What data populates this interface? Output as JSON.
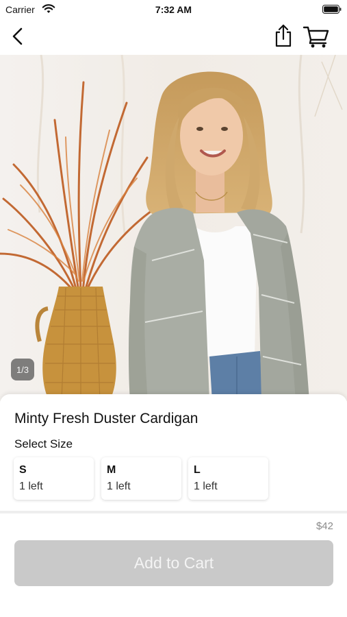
{
  "status_bar": {
    "carrier": "Carrier",
    "time": "7:32 AM"
  },
  "nav_bar": {
    "back_icon": "chevron-left-icon",
    "share_icon": "share-icon",
    "cart_icon": "cart-icon"
  },
  "gallery": {
    "counter": "1/3"
  },
  "product": {
    "title": "Minty Fresh Duster Cardigan",
    "select_size_label": "Select Size",
    "sizes": [
      {
        "label": "S",
        "stock": "1 left"
      },
      {
        "label": "M",
        "stock": "1 left"
      },
      {
        "label": "L",
        "stock": "1 left"
      }
    ],
    "price": "$42",
    "add_to_cart_label": "Add to Cart"
  },
  "colors": {
    "button_disabled": "#c9c9c9",
    "button_text": "#f4f4f4",
    "price_text": "#8a8a8a"
  }
}
